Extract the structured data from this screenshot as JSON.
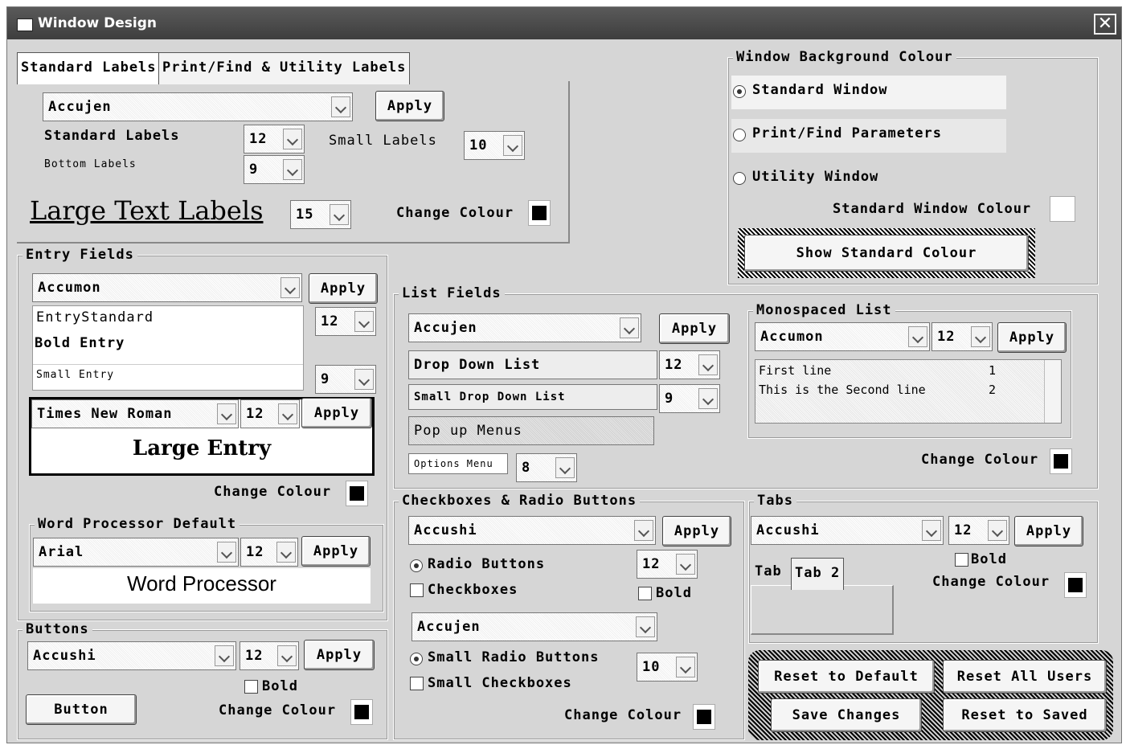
{
  "window": {
    "title": "Window Design",
    "close_glyph": "✕"
  },
  "labels_tabs": {
    "tab1": "Standard Labels",
    "tab2": "Print/Find & Utility Labels"
  },
  "labels_panel": {
    "font": "Accujen",
    "apply": "Apply",
    "standard_labels": "Standard Labels",
    "standard_size": "12",
    "small_labels": "Small Labels",
    "small_size": "10",
    "bottom_labels": "Bottom Labels",
    "bottom_size": "9",
    "large_text_labels": "Large Text Labels",
    "large_size": "15",
    "change_colour": "Change Colour"
  },
  "window_bg": {
    "legend": "Window Background Colour",
    "options": [
      "Standard Window",
      "Print/Find Parameters",
      "Utility Window"
    ],
    "selected": "Standard Window",
    "colour_label": "Standard Window Colour",
    "show_button": "Show Standard Colour"
  },
  "entry_fields": {
    "legend": "Entry Fields",
    "font": "Accumon",
    "apply": "Apply",
    "standard": "EntryStandard",
    "bold": "Bold Entry",
    "small": "Small Entry",
    "size1": "12",
    "size2": "9",
    "large_font": "Times New Roman",
    "large_size": "12",
    "large_apply": "Apply",
    "large_entry": "Large Entry",
    "change_colour": "Change Colour"
  },
  "word_processor": {
    "legend": "Word Processor Default",
    "font": "Arial",
    "size": "12",
    "apply": "Apply",
    "sample": "Word Processor"
  },
  "buttons": {
    "legend": "Buttons",
    "font": "Accushi",
    "size": "12",
    "apply": "Apply",
    "bold": "Bold",
    "button": "Button",
    "change_colour": "Change Colour"
  },
  "list_fields": {
    "legend": "List Fields",
    "font": "Accujen",
    "apply": "Apply",
    "drop_down": "Drop Down List",
    "drop_size": "12",
    "small_drop": "Small Drop Down List",
    "small_size": "9",
    "popup": "Pop up Menus",
    "options": "Options Menu",
    "options_size": "8"
  },
  "mono_list": {
    "legend": "Monospaced List",
    "font": "Accumon",
    "size": "12",
    "apply": "Apply",
    "rows": [
      {
        "text": "First line",
        "num": "1"
      },
      {
        "text": "This is the Second line",
        "num": "2"
      }
    ],
    "change_colour": "Change Colour"
  },
  "checkboxes": {
    "legend": "Checkboxes & Radio Buttons",
    "font": "Accushi",
    "apply": "Apply",
    "radio": "Radio Buttons",
    "checkboxes": "Checkboxes",
    "size": "12",
    "bold": "Bold",
    "font2": "Accujen",
    "small_radio": "Small Radio Buttons",
    "small_check": "Small Checkboxes",
    "size2": "10",
    "change_colour": "Change Colour"
  },
  "tabs": {
    "legend": "Tabs",
    "font": "Accushi",
    "size": "12",
    "apply": "Apply",
    "bold": "Bold",
    "change_colour": "Change Colour",
    "tab1": "Tab",
    "tab2": "Tab 2"
  },
  "actions": {
    "reset_default": "Reset to Default",
    "reset_all": "Reset All Users",
    "save": "Save Changes",
    "reset_saved": "Reset to Saved"
  }
}
